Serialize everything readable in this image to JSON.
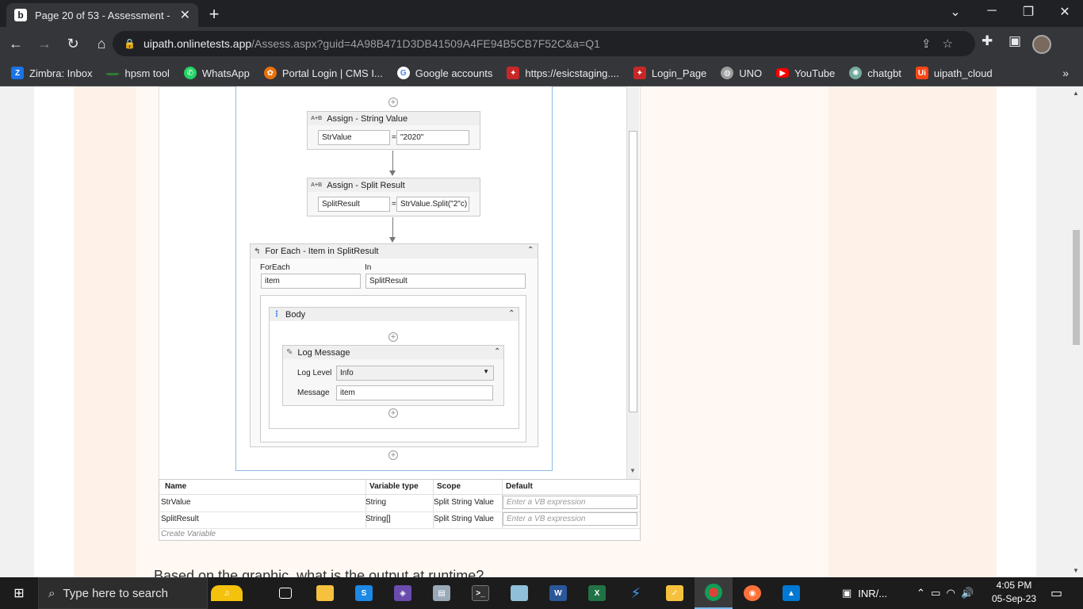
{
  "browser": {
    "tab_title": "Page 20 of 53 - Assessment - UiP",
    "tab_close": "✕",
    "new_tab": "+",
    "url_host": "uipath.onlinetests.app",
    "url_path": "/Assess.aspx?guid=4A98B471D3DB41509A4FE94B5CB7F52C&a=Q1",
    "bookmarks": [
      {
        "label": "Zimbra: Inbox",
        "icon": "Z",
        "color": "#1a73e8"
      },
      {
        "label": "hpsm tool",
        "icon": "",
        "color": "#2e7d32"
      },
      {
        "label": "WhatsApp",
        "icon": "W",
        "color": "#25d366"
      },
      {
        "label": "Portal Login | CMS I...",
        "icon": "",
        "color": "#e8710a"
      },
      {
        "label": "Google accounts",
        "icon": "G",
        "color": "#ffffff"
      },
      {
        "label": "https://esicstaging....",
        "icon": "",
        "color": "#c62828"
      },
      {
        "label": "Login_Page",
        "icon": "",
        "color": "#c62828"
      },
      {
        "label": "UNO",
        "icon": "",
        "color": "#9e9e9e"
      },
      {
        "label": "YouTube",
        "icon": "▶",
        "color": "#ff0000"
      },
      {
        "label": "chatgbt",
        "icon": "",
        "color": "#74aa9c"
      },
      {
        "label": "uipath_cloud",
        "icon": "Ui",
        "color": "#fa4616"
      }
    ],
    "bookmarks_more": "»"
  },
  "workflow": {
    "assign1": {
      "title": "Assign - String Value",
      "to": "StrValue",
      "eq": "=",
      "value": "\"2020\""
    },
    "assign2": {
      "title": "Assign - Split Result",
      "to": "SplitResult",
      "eq": "=",
      "value": "StrValue.Split(\"2\"c)"
    },
    "foreach": {
      "title": "For Each - Item in SplitResult",
      "foreach_label": "ForEach",
      "foreach_value": "item",
      "in_label": "In",
      "in_value": "SplitResult",
      "body_title": "Body",
      "log": {
        "title": "Log Message",
        "level_label": "Log Level",
        "level_value": "Info",
        "message_label": "Message",
        "message_value": "item"
      }
    }
  },
  "variables": {
    "headers": [
      "Name",
      "Variable type",
      "Scope",
      "Default"
    ],
    "rows": [
      {
        "name": "StrValue",
        "type": "String",
        "scope": "Split String Value",
        "default": "Enter a VB expression"
      },
      {
        "name": "SplitResult",
        "type": "String[]",
        "scope": "Split String Value",
        "default": "Enter a VB expression"
      }
    ],
    "create": "Create Variable"
  },
  "question": "Based on the graphic, what is the output at runtime?",
  "taskbar": {
    "search_placeholder": "Type here to search",
    "currency": "INR/...",
    "time": "4:05 PM",
    "date": "05-Sep-23"
  }
}
